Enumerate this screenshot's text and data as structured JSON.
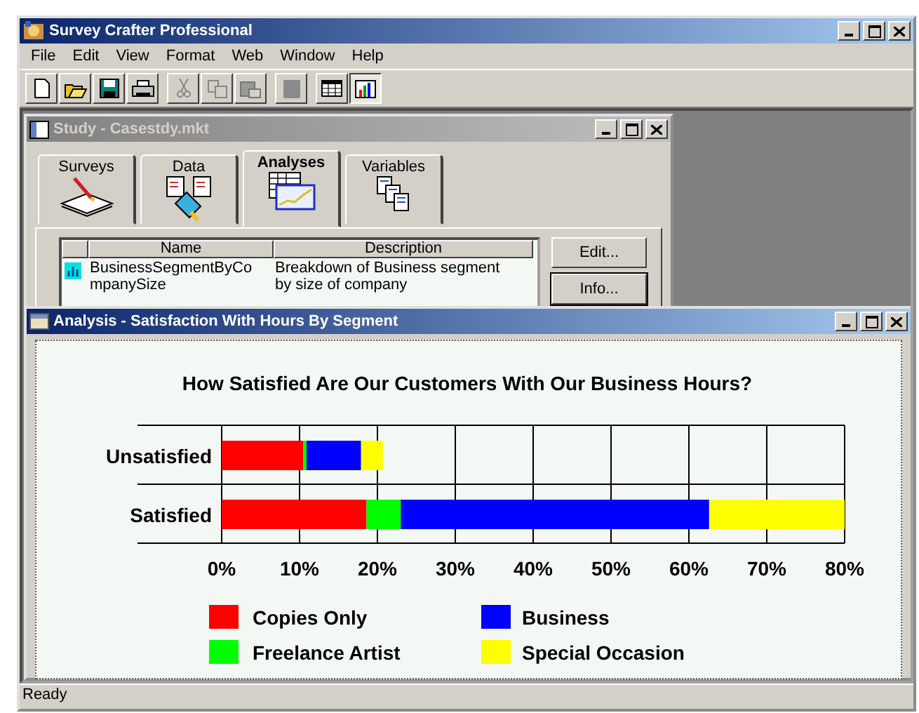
{
  "window": {
    "title": "Survey Crafter Professional"
  },
  "menu": [
    "File",
    "Edit",
    "View",
    "Format",
    "Web",
    "Window",
    "Help"
  ],
  "study_window": {
    "title": "Study - Casestdy.mkt",
    "tabs": [
      {
        "label": "Surveys",
        "selected": false
      },
      {
        "label": "Data",
        "selected": false
      },
      {
        "label": "Analyses",
        "selected": true
      },
      {
        "label": "Variables",
        "selected": false
      }
    ],
    "table": {
      "columns": [
        "Name",
        "Description"
      ],
      "rows": [
        {
          "name": "BusinessSegmentByCo\nmpanySize",
          "description": "Breakdown of Business segment\nby size of company"
        }
      ]
    },
    "buttons": [
      "Edit...",
      "Info..."
    ]
  },
  "analysis_window": {
    "title": "Analysis - Satisfaction With Hours By Segment",
    "chart_data": {
      "type": "bar",
      "orientation": "horizontal",
      "stacked": true,
      "title": "How Satisfied Are Our Customers With Our Business Hours?",
      "categories": [
        "Unsatisfied",
        "Satisfied"
      ],
      "series": [
        {
          "name": "Copies Only",
          "color": "#ff0000",
          "values": [
            10.5,
            18.6
          ]
        },
        {
          "name": "Freelance Artist",
          "color": "#00ff00",
          "values": [
            0.4,
            4.4
          ]
        },
        {
          "name": "Business",
          "color": "#0000ff",
          "values": [
            7.0,
            39.6
          ]
        },
        {
          "name": "Special Occasion",
          "color": "#ffff00",
          "values": [
            2.8,
            17.4
          ]
        }
      ],
      "grid": true,
      "legend": true,
      "xlim": [
        0,
        80
      ],
      "xticks": [
        {
          "value": 0,
          "label": "0%"
        },
        {
          "value": 10,
          "label": "10%"
        },
        {
          "value": 20,
          "label": "20%"
        },
        {
          "value": 30,
          "label": "30%"
        },
        {
          "value": 40,
          "label": "40%"
        },
        {
          "value": 50,
          "label": "50%"
        },
        {
          "value": 60,
          "label": "60%"
        },
        {
          "value": 70,
          "label": "70%"
        },
        {
          "value": 80,
          "label": "80%"
        }
      ]
    }
  },
  "status_bar": "Ready"
}
